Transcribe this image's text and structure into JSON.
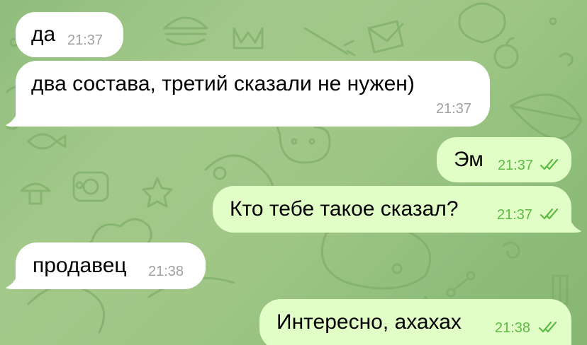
{
  "messages": [
    {
      "direction": "incoming",
      "text": "да",
      "time": "21:37"
    },
    {
      "direction": "incoming",
      "text": "два состава, третий сказали не нужен)",
      "time": "21:37"
    },
    {
      "direction": "outgoing",
      "text": "Эм",
      "time": "21:37",
      "status": "read"
    },
    {
      "direction": "outgoing",
      "text": "Кто тебе такое сказал?",
      "time": "21:37",
      "status": "read"
    },
    {
      "direction": "incoming",
      "text": "продавец",
      "time": "21:38"
    },
    {
      "direction": "outgoing",
      "text": "Интересно, ахахах",
      "time": "21:38",
      "status": "read"
    }
  ],
  "colors": {
    "incoming_bubble": "#ffffff",
    "outgoing_bubble": "#e1fec6",
    "outgoing_time": "#5dbb45",
    "incoming_time": "#a0a0a0",
    "background": "#9fc685"
  },
  "icons": {
    "read_status": "double-check-icon"
  }
}
